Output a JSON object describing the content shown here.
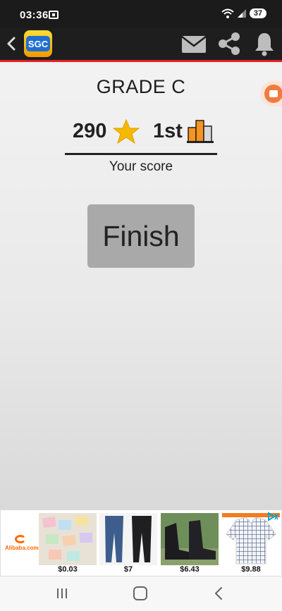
{
  "status_bar": {
    "time": "03:36",
    "battery": "37"
  },
  "app_bar": {
    "logo_text": "SGC"
  },
  "result": {
    "grade": "GRADE C",
    "score": "290",
    "rank": "1st",
    "caption": "Your score",
    "finish_label": "Finish"
  },
  "ad": {
    "brand": "Alibaba.com",
    "products": [
      {
        "price": "$0.03"
      },
      {
        "price": "$7"
      },
      {
        "price": "$6.43"
      },
      {
        "price": "$9.88"
      }
    ]
  },
  "colors": {
    "accent_red": "#e31e24",
    "star_gold": "#f6b800",
    "button_gray": "#a9a9a9"
  },
  "icons": [
    "back-chevron-icon",
    "mail-icon",
    "share-icon",
    "bell-icon",
    "star-icon",
    "podium-icon",
    "ad-choices-icon"
  ]
}
